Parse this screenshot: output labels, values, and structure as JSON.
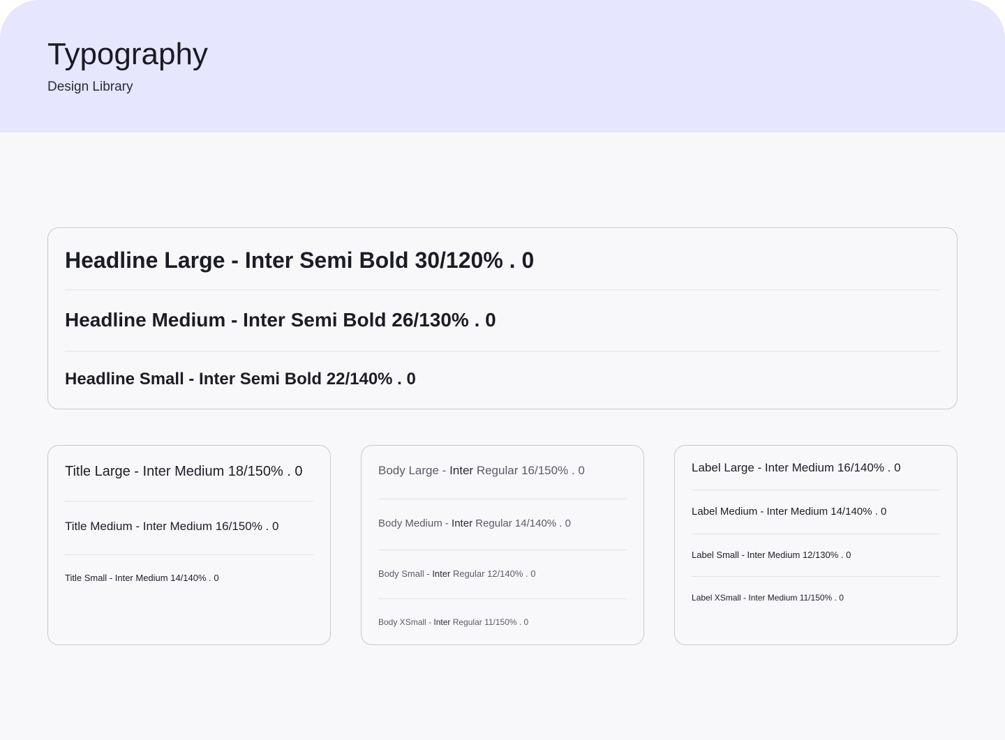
{
  "header": {
    "title": "Typography",
    "subtitle": "Design Library"
  },
  "headlines": [
    "Headline Large - Inter Semi Bold 30/120% . 0",
    "Headline Medium - Inter Semi Bold 26/130% . 0",
    "Headline Small - Inter Semi Bold 22/140% . 0"
  ],
  "titles": [
    "Title Large - Inter Medium 18/150% . 0",
    "Title Medium - Inter Medium 16/150% . 0",
    "Title Small - Inter Medium 14/140% . 0"
  ],
  "body": [
    {
      "name": "Body Large - ",
      "font": "Inter",
      "spec": " Regular 16/150% . 0"
    },
    {
      "name": "Body Medium - ",
      "font": "Inter",
      "spec": " Regular 14/140% . 0"
    },
    {
      "name": "Body Small - ",
      "font": "Inter",
      "spec": " Regular 12/140% . 0"
    },
    {
      "name": "Body XSmall - ",
      "font": "Inter",
      "spec": " Regular 11/150% . 0"
    }
  ],
  "labels": [
    "Label Large - Inter Medium 16/140% . 0",
    "Label Medium - Inter Medium 14/140% . 0",
    "Label Small - Inter Medium 12/130% . 0",
    "Label XSmall - Inter Medium 11/150% . 0"
  ],
  "colors": {
    "header_bg": "#e7e6ff",
    "page_bg": "#f8f8fb",
    "card_border": "#c9c9cf",
    "divider": "#e3e3e8",
    "text_primary": "#1a1a24",
    "text_muted": "#5a5a66"
  }
}
